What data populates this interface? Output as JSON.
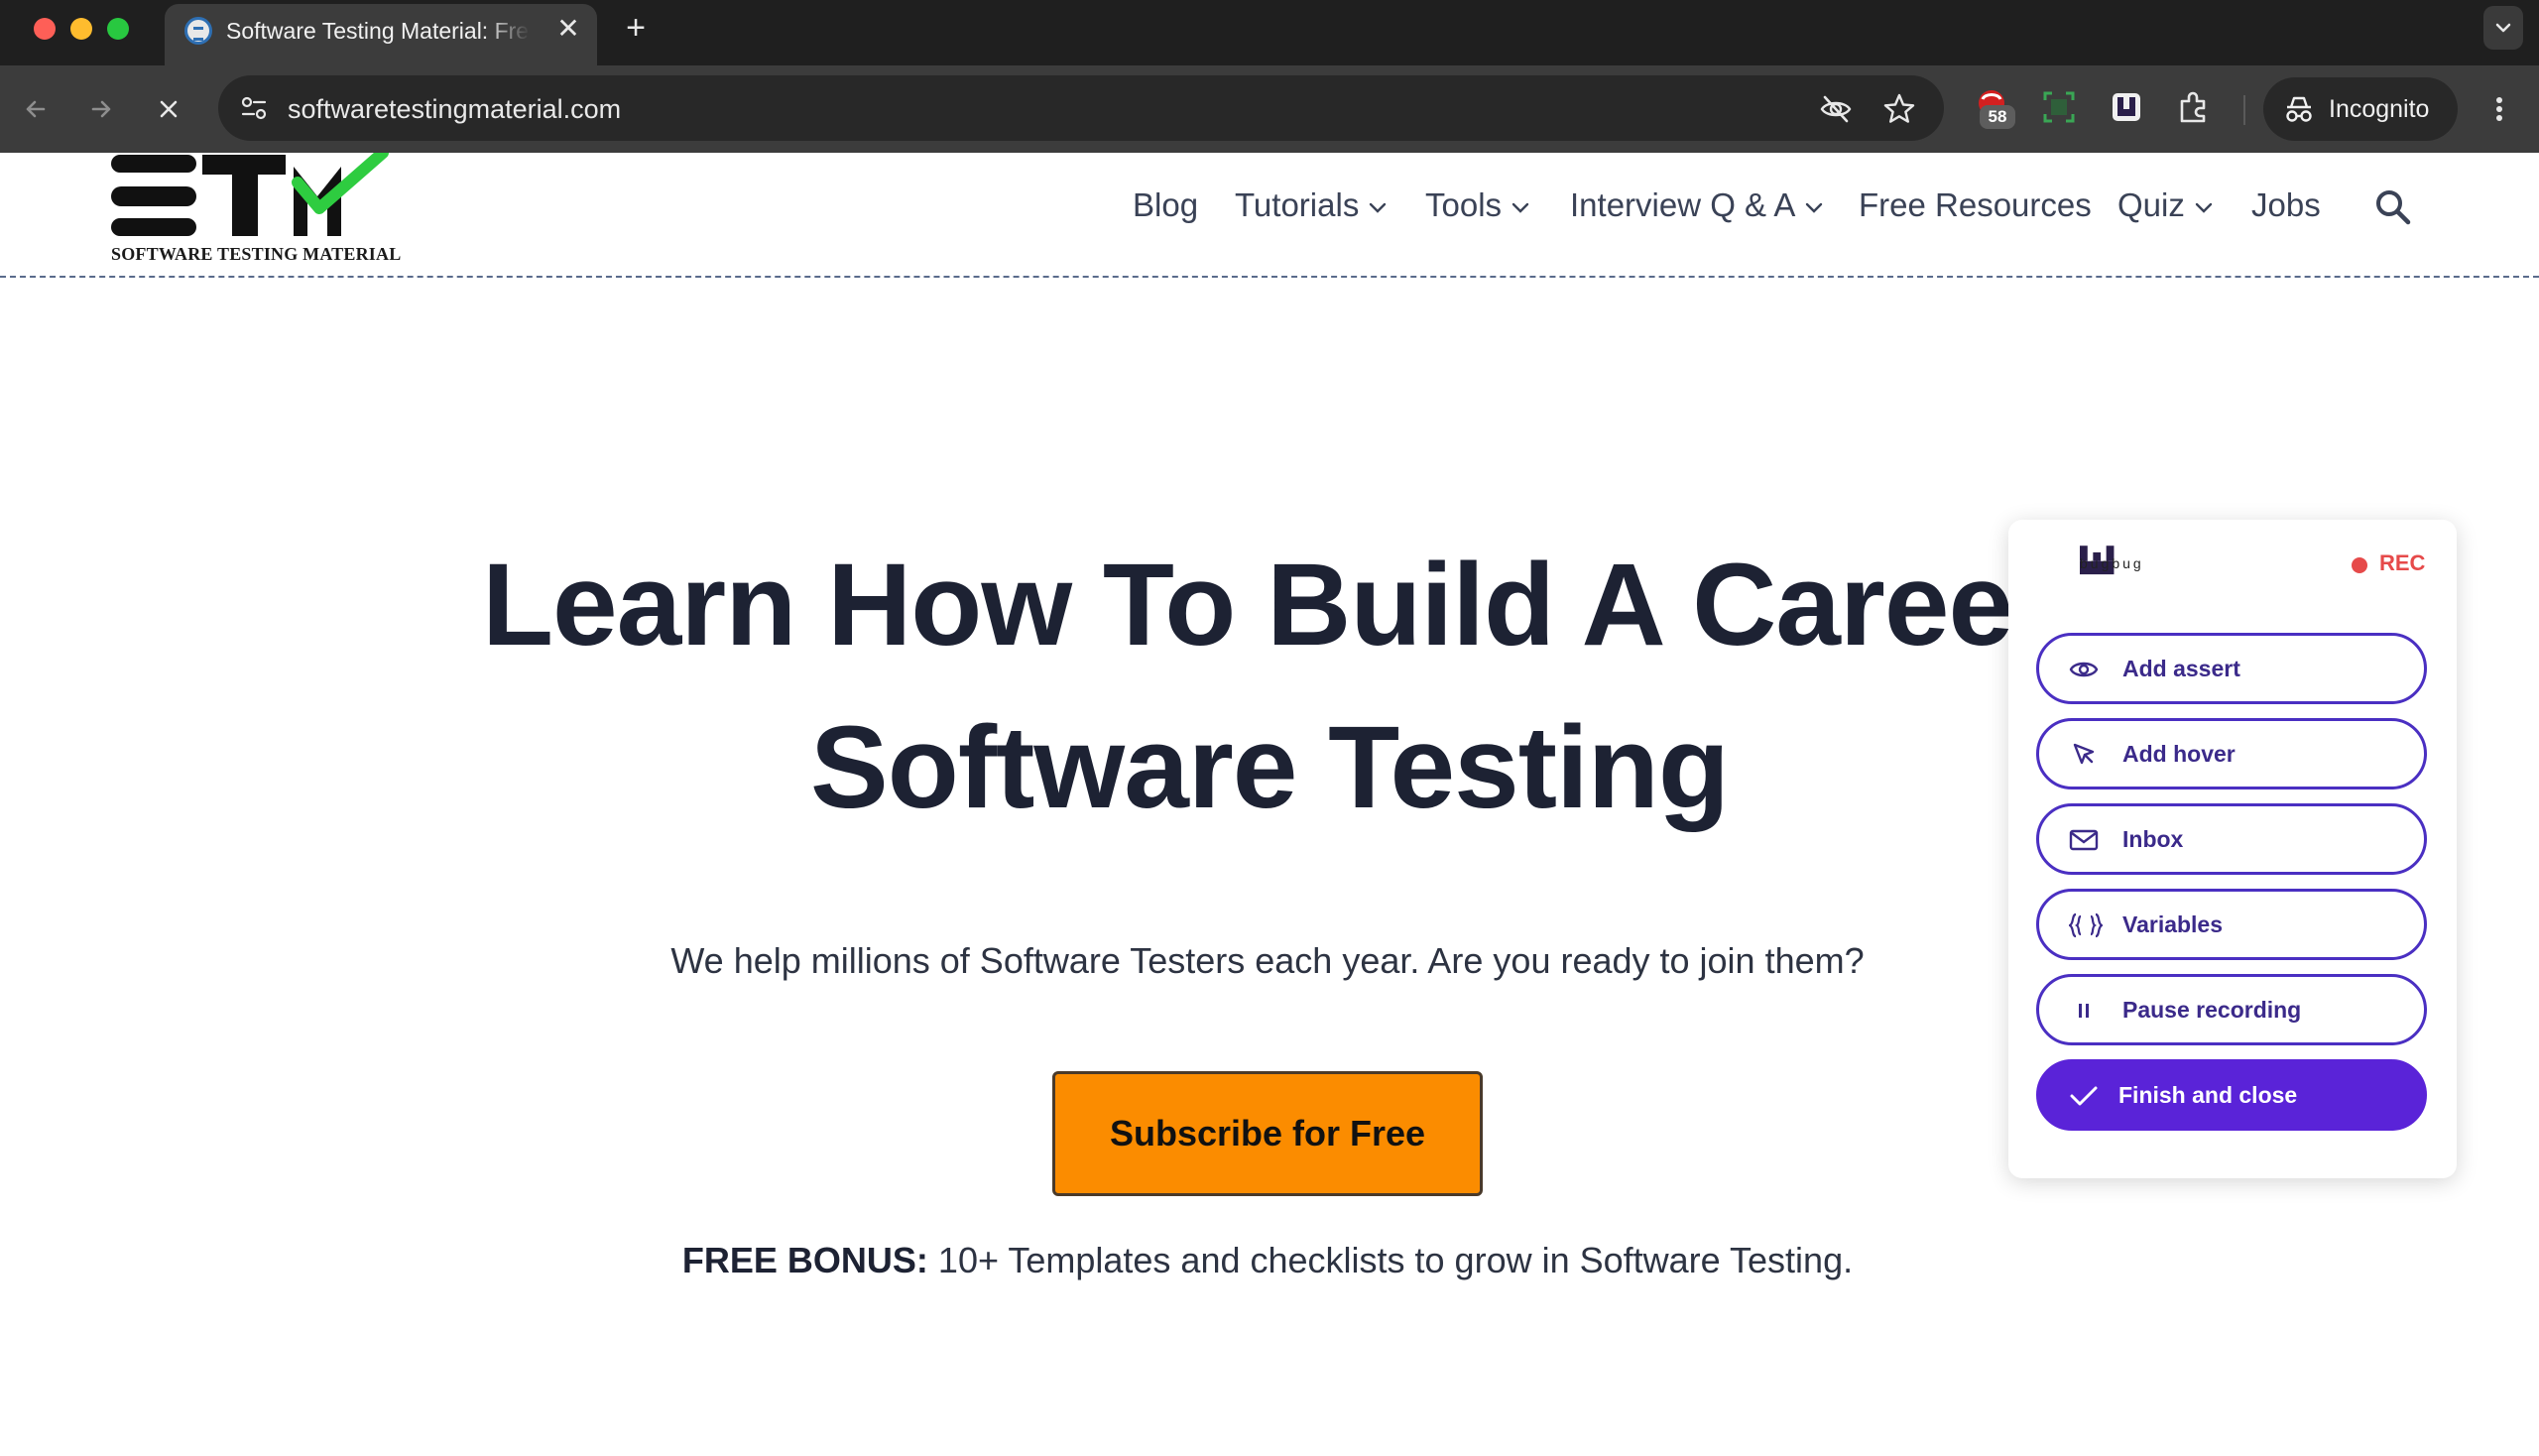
{
  "browser": {
    "tab_title": "Software Testing Material: Free Software Testing Tutorials",
    "url": "softwaretestingmaterial.com",
    "extension_badge": "58",
    "profile_label": "Incognito"
  },
  "site": {
    "logo_caption": "SOFTWARE TESTING MATERIAL",
    "nav": [
      {
        "label": "Blog"
      },
      {
        "label": "Tutorials"
      },
      {
        "label": "Tools"
      },
      {
        "label": "Interview Q & A"
      },
      {
        "label": "Free Resources"
      },
      {
        "label": "Quiz"
      },
      {
        "label": "Jobs"
      }
    ]
  },
  "hero": {
    "title_line1": "Learn How To Build A Career",
    "title_line2": "Software Testing",
    "subtitle": "We help millions of Software Testers each year. Are you ready to join them?",
    "cta_label": "Subscribe for Free",
    "bonus_label": "FREE BONUS:",
    "bonus_text": " 10+ Templates and checklists to grow in Software Testing."
  },
  "bugbug": {
    "brand": "bugbug",
    "status": "REC",
    "actions": [
      {
        "label": "Add assert",
        "icon": "eye-icon"
      },
      {
        "label": "Add hover",
        "icon": "cursor-icon"
      },
      {
        "label": "Inbox",
        "icon": "mail-icon"
      },
      {
        "label": "Variables",
        "icon": "braces-icon"
      },
      {
        "label": "Pause recording",
        "icon": "pause-icon"
      },
      {
        "label": "Finish and close",
        "icon": "check-icon"
      }
    ]
  },
  "colors": {
    "cta": "#fb8c00",
    "bugbug_primary": "#5a23d8",
    "rec": "#e64a4a"
  }
}
